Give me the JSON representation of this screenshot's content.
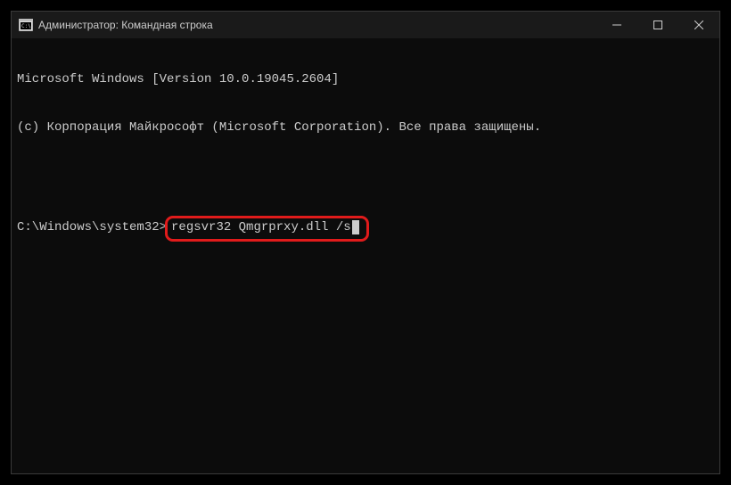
{
  "window": {
    "title": "Администратор: Командная строка"
  },
  "console": {
    "line1": "Microsoft Windows [Version 10.0.19045.2604]",
    "line2": "(c) Корпорация Майкрософт (Microsoft Corporation). Все права защищены.",
    "prompt": "C:\\Windows\\system32>",
    "command": "regsvr32 Qmgrprxy.dll /s"
  }
}
